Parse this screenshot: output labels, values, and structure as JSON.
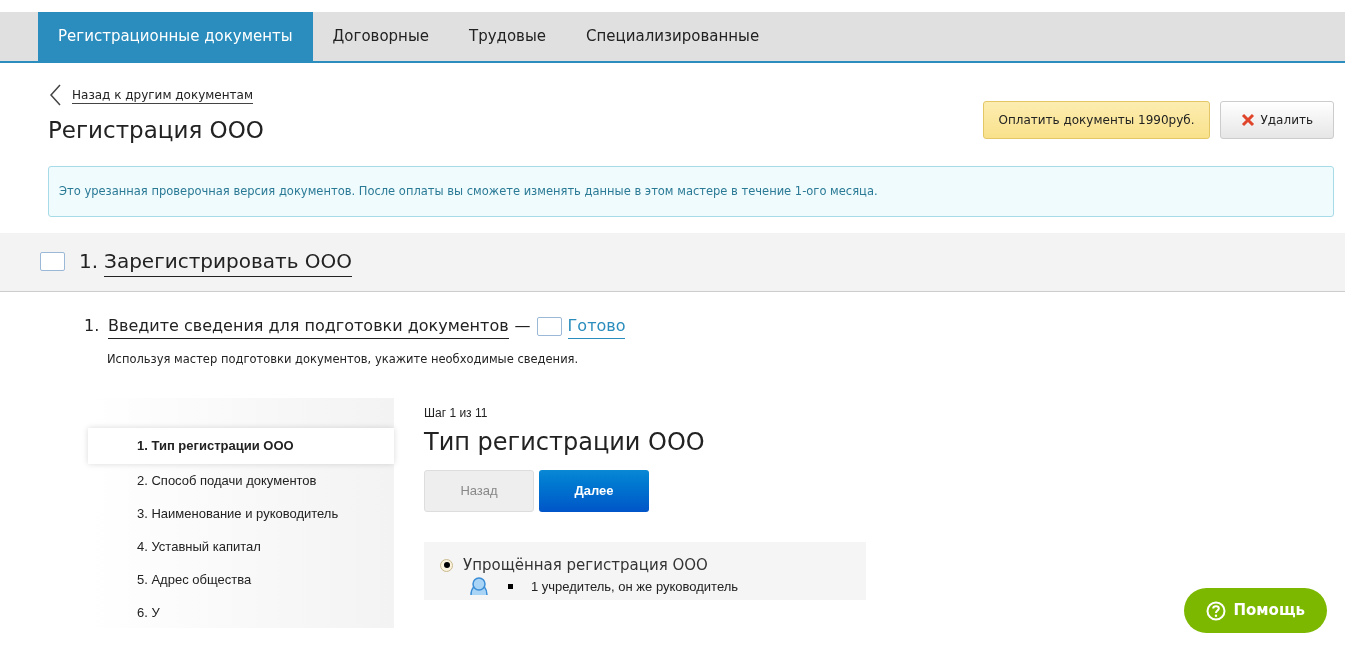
{
  "tabs": [
    {
      "label": "Регистрационные документы",
      "selected": true
    },
    {
      "label": "Договорные",
      "selected": false
    },
    {
      "label": "Трудовые",
      "selected": false
    },
    {
      "label": "Специализированные",
      "selected": false
    }
  ],
  "back_link": "Назад к другим документам",
  "title": "Регистрация ООО",
  "actions": {
    "pay": "Оплатить документы 1990руб.",
    "delete": "Удалить"
  },
  "notice": "Это урезанная проверочная версия документов. После оплаты вы сможете изменять данные в этом мастере в течение 1-ого месяца.",
  "section": {
    "number": "1.",
    "title": "Зарегистрировать ООО",
    "checked": false
  },
  "step": {
    "number": "1.",
    "title": "Введите сведения для подготовки документов",
    "dash": "—",
    "checked": false,
    "done_label": "Готово",
    "description": "Используя мастер подготовки документов, укажите необходимые сведения."
  },
  "wizard": {
    "steps": [
      {
        "label": "1. Тип регистрации ООО",
        "selected": true
      },
      {
        "label": "2. Способ подачи документов",
        "selected": false
      },
      {
        "label": "3. Наименование и руководитель",
        "selected": false
      },
      {
        "label": "4. Уставный капитал",
        "selected": false
      },
      {
        "label": "5. Адрес общества",
        "selected": false
      },
      {
        "label": "6. У",
        "selected": false
      }
    ],
    "counter": "Шаг 1 из 11",
    "heading": "Тип регистрации ООО",
    "buttons": {
      "back": "Назад",
      "next": "Далее"
    },
    "option": {
      "label": "Упрощённая регистрация ООО",
      "selected": true,
      "bullet": "1 учредитель, он же руководитель"
    }
  },
  "help": "Помощь"
}
